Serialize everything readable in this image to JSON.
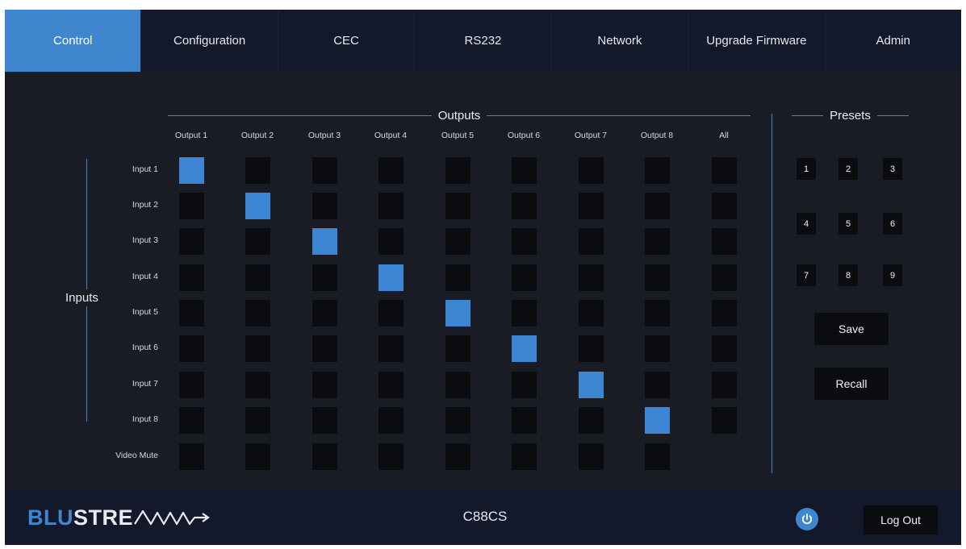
{
  "nav": {
    "tabs": [
      {
        "label": "Control",
        "active": true
      },
      {
        "label": "Configuration",
        "active": false
      },
      {
        "label": "CEC",
        "active": false
      },
      {
        "label": "RS232",
        "active": false
      },
      {
        "label": "Network",
        "active": false
      },
      {
        "label": "Upgrade Firmware",
        "active": false
      },
      {
        "label": "Admin",
        "active": false
      }
    ]
  },
  "matrix": {
    "outputs_title": "Outputs",
    "inputs_title": "Inputs",
    "columns": [
      "Output 1",
      "Output 2",
      "Output 3",
      "Output 4",
      "Output 5",
      "Output 6",
      "Output 7",
      "Output 8",
      "All"
    ],
    "rows": [
      {
        "label": "Input 1",
        "route": [
          true,
          false,
          false,
          false,
          false,
          false,
          false,
          false,
          false
        ]
      },
      {
        "label": "Input 2",
        "route": [
          false,
          true,
          false,
          false,
          false,
          false,
          false,
          false,
          false
        ]
      },
      {
        "label": "Input 3",
        "route": [
          false,
          false,
          true,
          false,
          false,
          false,
          false,
          false,
          false
        ]
      },
      {
        "label": "Input 4",
        "route": [
          false,
          false,
          false,
          true,
          false,
          false,
          false,
          false,
          false
        ]
      },
      {
        "label": "Input 5",
        "route": [
          false,
          false,
          false,
          false,
          true,
          false,
          false,
          false,
          false
        ]
      },
      {
        "label": "Input 6",
        "route": [
          false,
          false,
          false,
          false,
          false,
          true,
          false,
          false,
          false
        ]
      },
      {
        "label": "Input 7",
        "route": [
          false,
          false,
          false,
          false,
          false,
          false,
          true,
          false,
          false
        ]
      },
      {
        "label": "Input 8",
        "route": [
          false,
          false,
          false,
          false,
          false,
          false,
          false,
          true,
          false
        ]
      },
      {
        "label": "Video Mute",
        "route": [
          false,
          false,
          false,
          false,
          false,
          false,
          false,
          false,
          null
        ]
      }
    ]
  },
  "presets": {
    "title": "Presets",
    "numbers": [
      "1",
      "2",
      "3",
      "4",
      "5",
      "6",
      "7",
      "8",
      "9"
    ],
    "save_label": "Save",
    "recall_label": "Recall"
  },
  "footer": {
    "logo_blu": "BLU",
    "logo_stre": "STRE",
    "device": "C88CS",
    "logout_label": "Log Out"
  },
  "colors": {
    "accent": "#3f86ce",
    "background": "#1a1c25",
    "bar": "#13182a",
    "cell": "#0b0c10"
  }
}
